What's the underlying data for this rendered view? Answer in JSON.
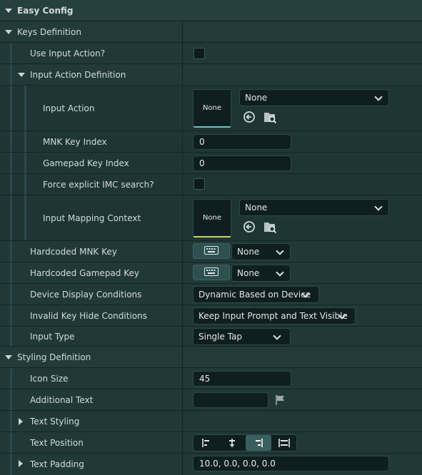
{
  "sections": {
    "easy_config": "Easy Config",
    "keys_definition": "Keys Definition",
    "input_action_definition": "Input Action Definition",
    "styling_definition": "Styling Definition"
  },
  "props": {
    "use_input_action": "Use Input Action?",
    "input_action": "Input Action",
    "mnk_key_index": "MNK Key Index",
    "gamepad_key_index": "Gamepad Key Index",
    "force_imc_search": "Force explicit IMC search?",
    "input_mapping_context": "Input Mapping Context",
    "hardcoded_mnk_key": "Hardcoded MNK Key",
    "hardcoded_gamepad_key": "Hardcoded Gamepad Key",
    "device_display_conditions": "Device Display Conditions",
    "invalid_key_hide_conditions": "Invalid Key Hide Conditions",
    "input_type": "Input Type",
    "icon_size": "Icon Size",
    "additional_text": "Additional Text",
    "text_styling": "Text Styling",
    "text_position": "Text Position",
    "text_padding": "Text Padding"
  },
  "values": {
    "input_action_thumb": "None",
    "input_action_select": "None",
    "mnk_key_index": "0",
    "gamepad_key_index": "0",
    "imc_thumb": "None",
    "imc_select": "None",
    "hardcoded_mnk_key": "None",
    "hardcoded_gamepad_key": "None",
    "device_display_conditions": "Dynamic Based on Device",
    "invalid_key_hide_conditions": "Keep Input Prompt and Text Visible",
    "input_type": "Single Tap",
    "icon_size": "45",
    "additional_text": "",
    "text_padding": "10.0, 0.0, 0.0, 0.0"
  },
  "state": {
    "use_input_action_checked": false,
    "force_imc_checked": false,
    "text_position_active": "right"
  },
  "colors": {
    "panel_bg": "#1f3434",
    "input_action_accent": "#5fc8c8",
    "imc_accent": "#c8d46a"
  }
}
